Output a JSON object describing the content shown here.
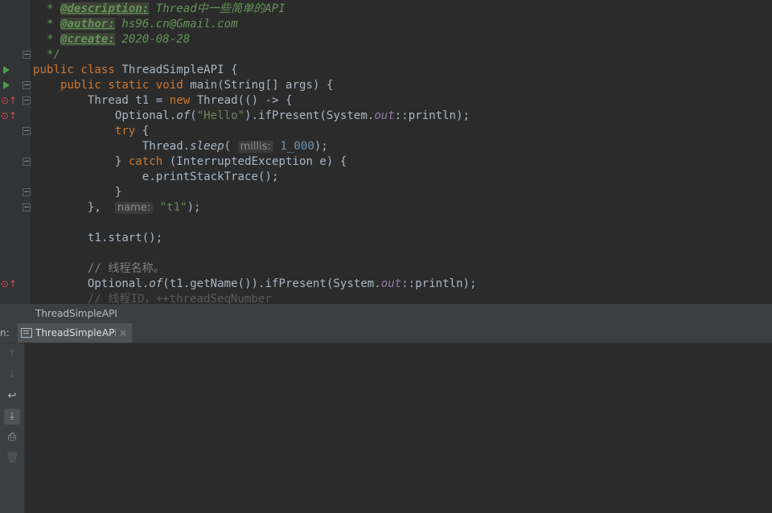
{
  "editor": {
    "javadoc": {
      "description_tag": "@description:",
      "description_text": "Thread中一些简单的API",
      "author_tag": "@author:",
      "author_text": "hs96.cn@Gmail.com",
      "create_tag": "@create:",
      "create_text": "2020-08-28",
      "star": "*",
      "close": "*/"
    },
    "class_line": {
      "kw1": "public",
      "kw2": "class",
      "name": "ThreadSimpleAPI",
      "brace": "{"
    },
    "main_line": {
      "kw1": "public",
      "kw2": "static",
      "kw3": "void",
      "rest": "main(String[] args) {"
    },
    "thread_line": {
      "pre": "Thread t1 = ",
      "kw": "new",
      "post": "Thread(() -> {"
    },
    "optional_hello": {
      "pre": "Optional.",
      "of": "of",
      "open": "(",
      "str": "\"Hello\"",
      "mid": ").ifPresent(System.",
      "out": "out",
      "post": "::println);"
    },
    "try_line": {
      "kw": "try",
      "post": "{"
    },
    "sleep_line": {
      "pre": "Thread.",
      "sleep": "sleep",
      "open": "(",
      "hint": "millis:",
      "num": "1_000",
      "post": ");"
    },
    "catch_line": {
      "pre": "} ",
      "kw": "catch",
      "post": "(InterruptedException e) {"
    },
    "stack_line": "e.printStackTrace();",
    "close_brace": "}",
    "thread_close": {
      "pre": "},",
      "hint": "name:",
      "str": "\"t1\"",
      "post": ");"
    },
    "start_line": "t1.start();",
    "comment_name": "// 线程名称。",
    "optional_name": {
      "pre": "Optional.",
      "of": "of",
      "mid": "(t1.getName()).ifPresent(System.",
      "out": "out",
      "post": "::println);"
    },
    "comment_id": "// 线程ID，++threadSeqNumber"
  },
  "run_window": {
    "title": "ThreadSimpleAPI",
    "tab_prefix": "n:",
    "tab_label": "ThreadSimpleAPI",
    "tab_close": "×"
  },
  "toolbar_icons": [
    "up-arrow-icon",
    "down-arrow-icon",
    "soft-wrap-icon",
    "scroll-to-end-icon",
    "print-icon",
    "trash-icon"
  ],
  "colors": {
    "background": "#2b2b2b",
    "keyword": "#cc7832",
    "string": "#6a8759",
    "number": "#6897bb",
    "field": "#9876aa",
    "javadoc": "#629755",
    "comment": "#808080",
    "run_icon": "#499c54",
    "override_icon": "#c75450"
  }
}
